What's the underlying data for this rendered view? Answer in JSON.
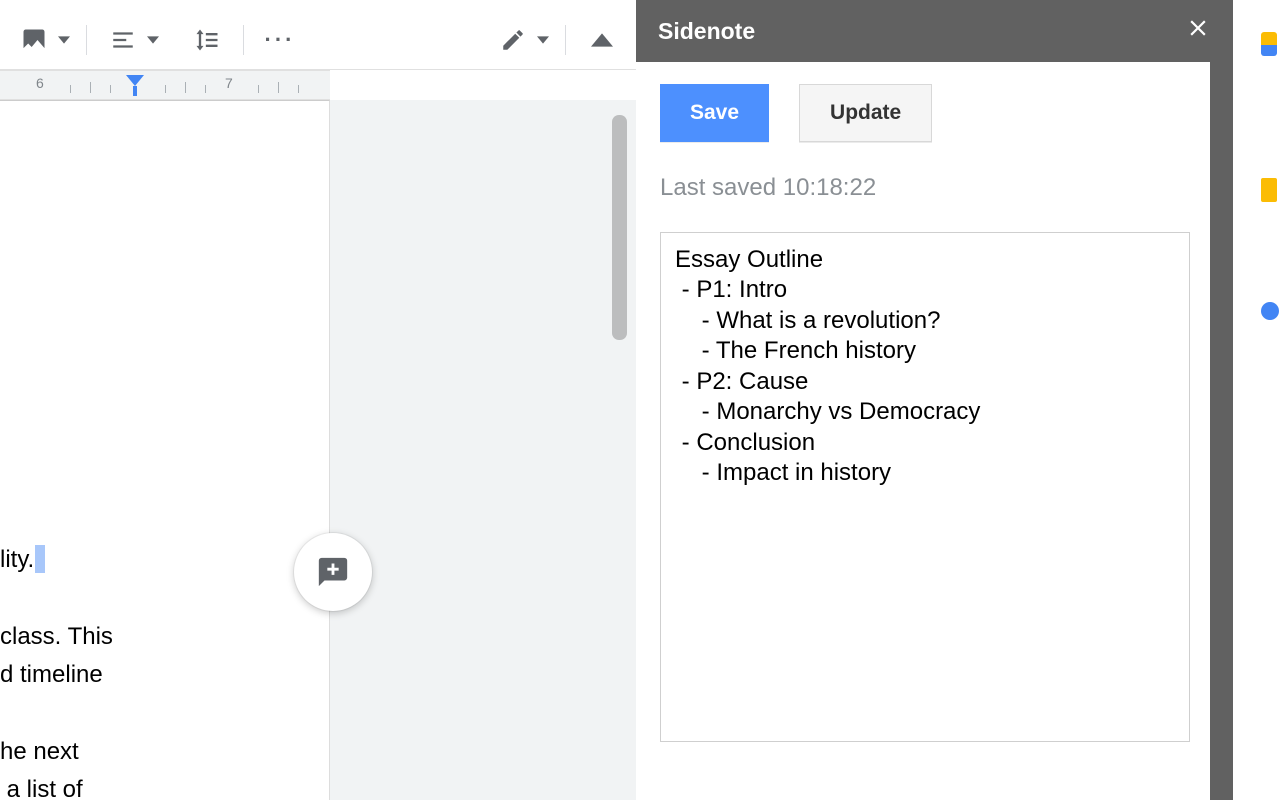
{
  "toolbar": {
    "image_btn": "Insert image",
    "align_btn": "Align",
    "spacing_btn": "Line spacing",
    "more_btn": "More",
    "edit_mode_btn": "Editing mode",
    "collapse_btn": "Hide menus"
  },
  "ruler": {
    "marks": [
      "6",
      "7"
    ]
  },
  "document": {
    "line1": "lity.",
    "line2": "class. This",
    "line3": "d timeline",
    "line4": "he next",
    "line5": " a list of"
  },
  "comment_fab_label": "Add comment",
  "sidenote": {
    "title": "Sidenote",
    "save_label": "Save",
    "update_label": "Update",
    "status": "Last saved 10:18:22",
    "note_text": "Essay Outline\n - P1: Intro\n    - What is a revolution?\n    - The French history\n - P2: Cause\n    - Monarchy vs Democracy\n - Conclusion\n    - Impact in history"
  }
}
